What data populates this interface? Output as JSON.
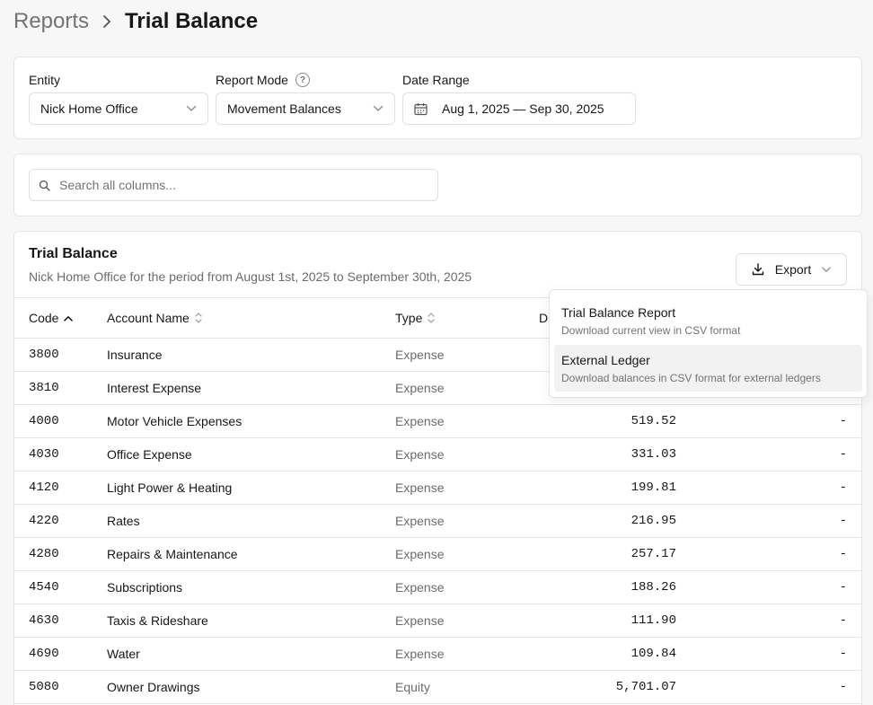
{
  "breadcrumb": {
    "parent": "Reports",
    "current": "Trial Balance"
  },
  "filters": {
    "entity_label": "Entity",
    "entity_value": "Nick Home Office",
    "mode_label": "Report Mode",
    "mode_value": "Movement Balances",
    "date_label": "Date Range",
    "date_value": "Aug 1, 2025 — Sep 30, 2025"
  },
  "search": {
    "placeholder": "Search all columns..."
  },
  "report": {
    "title": "Trial Balance",
    "subtitle": "Nick Home Office for the period from August 1st, 2025 to September 30th, 2025",
    "export_label": "Export"
  },
  "columns": {
    "code": "Code",
    "account": "Account Name",
    "type": "Type",
    "debit": "D"
  },
  "rows": [
    {
      "code": "3800",
      "account": "Insurance",
      "type": "Expense",
      "debit": "",
      "credit": ""
    },
    {
      "code": "3810",
      "account": "Interest Expense",
      "type": "Expense",
      "debit": "",
      "credit": ""
    },
    {
      "code": "4000",
      "account": "Motor Vehicle Expenses",
      "type": "Expense",
      "debit": "519.52",
      "credit": "-"
    },
    {
      "code": "4030",
      "account": "Office Expense",
      "type": "Expense",
      "debit": "331.03",
      "credit": "-"
    },
    {
      "code": "4120",
      "account": "Light Power & Heating",
      "type": "Expense",
      "debit": "199.81",
      "credit": "-"
    },
    {
      "code": "4220",
      "account": "Rates",
      "type": "Expense",
      "debit": "216.95",
      "credit": "-"
    },
    {
      "code": "4280",
      "account": "Repairs & Maintenance",
      "type": "Expense",
      "debit": "257.17",
      "credit": "-"
    },
    {
      "code": "4540",
      "account": "Subscriptions",
      "type": "Expense",
      "debit": "188.26",
      "credit": "-"
    },
    {
      "code": "4630",
      "account": "Taxis & Rideshare",
      "type": "Expense",
      "debit": "111.90",
      "credit": "-"
    },
    {
      "code": "4690",
      "account": "Water",
      "type": "Expense",
      "debit": "109.84",
      "credit": "-"
    },
    {
      "code": "5080",
      "account": "Owner Drawings",
      "type": "Equity",
      "debit": "5,701.07",
      "credit": "-"
    }
  ],
  "export_menu": [
    {
      "title": "Trial Balance Report",
      "desc": "Download current view in CSV format"
    },
    {
      "title": "External Ledger",
      "desc": "Download balances in CSV format for external ledgers"
    }
  ],
  "icons": {
    "chevron_right": "chevron-right-icon",
    "chevron_down": "chevron-down-icon",
    "help": "help-circle-icon",
    "calendar": "calendar-icon",
    "search": "search-icon",
    "download": "download-icon",
    "sort_up": "arrow-up-icon",
    "sort": "sort-icon"
  }
}
